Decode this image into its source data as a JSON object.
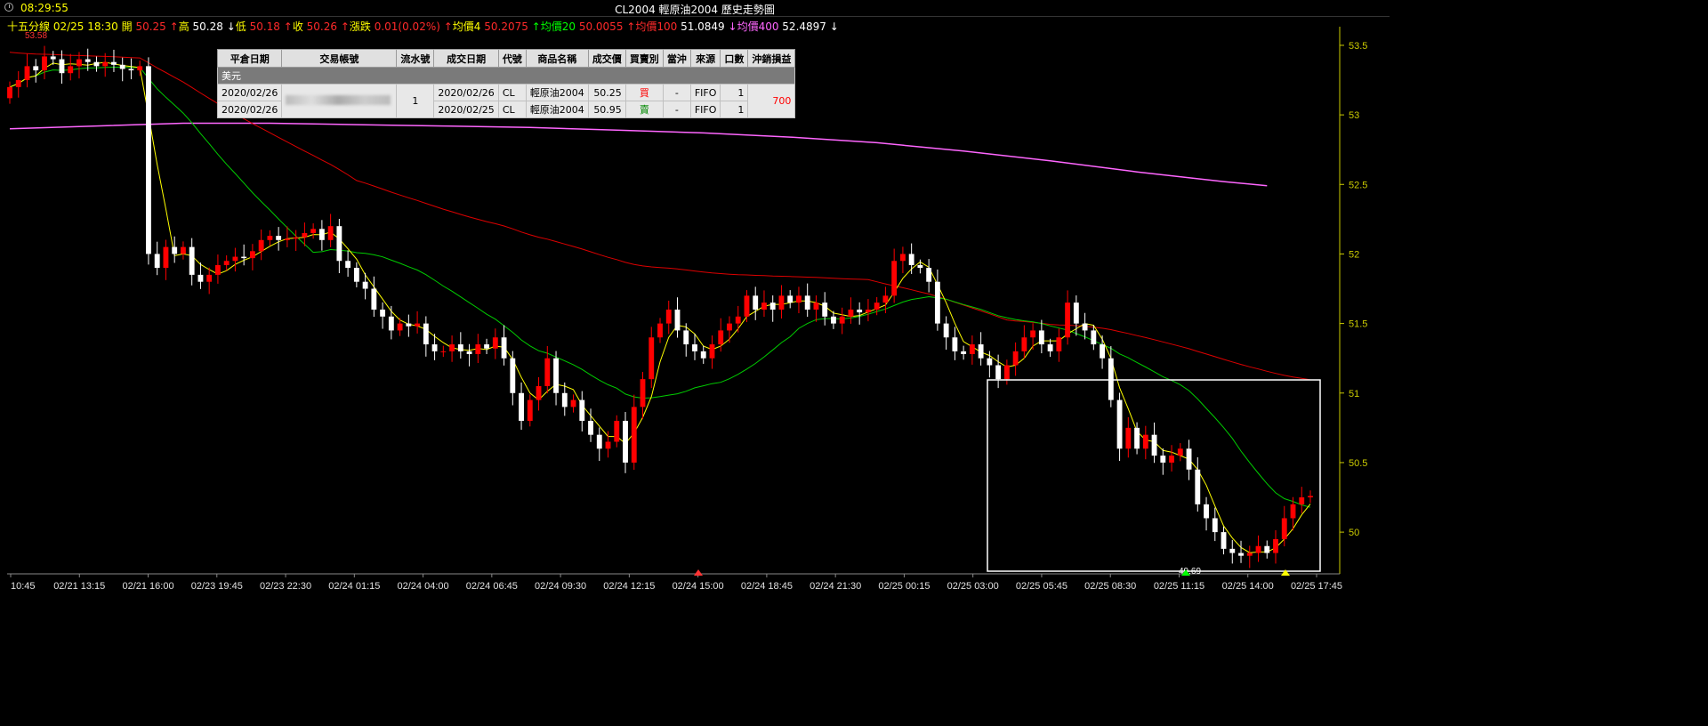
{
  "window": {
    "clock": "08:29:55",
    "title": "CL2004 輕原油2004  歷史走勢圖"
  },
  "info": [
    {
      "text": "十五分線",
      "color": "#ffff00"
    },
    {
      "text": " 02/25 18:30 ",
      "color": "#ffff00"
    },
    {
      "text": "開 ",
      "color": "#ffff00"
    },
    {
      "text": "50.25",
      "color": "#ff2a2a"
    },
    {
      "text": " ↑",
      "color": "#ff2a2a"
    },
    {
      "text": "高 ",
      "color": "#ffff00"
    },
    {
      "text": "50.28",
      "color": "#ffffff"
    },
    {
      "text": " ↓",
      "color": "#ffffff"
    },
    {
      "text": "低 ",
      "color": "#ffff00"
    },
    {
      "text": "50.18",
      "color": "#ff2a2a"
    },
    {
      "text": " ↑",
      "color": "#ff2a2a"
    },
    {
      "text": "收 ",
      "color": "#ffff00"
    },
    {
      "text": "50.26",
      "color": "#ff2a2a"
    },
    {
      "text": " ↑",
      "color": "#ff2a2a"
    },
    {
      "text": "漲跌 ",
      "color": "#ffff00"
    },
    {
      "text": "0.01(0.02%)",
      "color": "#ff2a2a"
    },
    {
      "text": " ↑",
      "color": "#ff2a2a"
    },
    {
      "text": "均價4 ",
      "color": "#ffff00"
    },
    {
      "text": "50.2075",
      "color": "#ff2a2a"
    },
    {
      "text": " ↑",
      "color": "#00ff00"
    },
    {
      "text": "均價20 ",
      "color": "#00ff00"
    },
    {
      "text": "50.0055",
      "color": "#ff2a2a"
    },
    {
      "text": " ↑",
      "color": "#ff2a2a"
    },
    {
      "text": "均價100 ",
      "color": "#ff2a2a"
    },
    {
      "text": "51.0849",
      "color": "#ffffff"
    },
    {
      "text": " ↓",
      "color": "#ff66ff"
    },
    {
      "text": "均價400 ",
      "color": "#ff66ff"
    },
    {
      "text": "52.4897",
      "color": "#ffffff"
    },
    {
      "text": " ↓",
      "color": "#ffffff"
    }
  ],
  "trades": {
    "headers": [
      "平倉日期",
      "交易帳號",
      "流水號",
      "成交日期",
      "代號",
      "商品名稱",
      "成交價",
      "買賣別",
      "當沖",
      "來源",
      "口數",
      "沖銷損益"
    ],
    "group": "美元",
    "serial": "1",
    "pnl": "700",
    "rows": [
      {
        "close_date": "2020/02/26",
        "trade_date": "2020/02/26",
        "symbol": "CL",
        "name": "輕原油2004",
        "price": "50.25",
        "side": "買",
        "side_color": "#ff0000",
        "daytrade": "-",
        "source": "FIFO",
        "qty": "1"
      },
      {
        "close_date": "2020/02/26",
        "trade_date": "2020/02/25",
        "symbol": "CL",
        "name": "輕原油2004",
        "price": "50.95",
        "side": "賣",
        "side_color": "#008800",
        "daytrade": "-",
        "source": "FIFO",
        "qty": "1"
      }
    ]
  },
  "chart_data": {
    "type": "candlestick",
    "interval": "十五分線",
    "ylim": [
      49.7,
      53.57
    ],
    "y_ticks": [
      "53.5",
      "53",
      "52.5",
      "52",
      "51.5",
      "51",
      "50.5",
      "50"
    ],
    "x_ticks": [
      "10:45",
      "02/21 13:15",
      "02/21 16:00",
      "02/23 19:45",
      "02/23 22:30",
      "02/24 01:15",
      "02/24 04:00",
      "02/24 06:45",
      "02/24 09:30",
      "02/24 12:15",
      "02/24 15:00",
      "02/24 18:45",
      "02/24 21:30",
      "02/25 00:15",
      "02/25 03:00",
      "02/25 05:45",
      "02/25 08:30",
      "02/25 11:15",
      "02/25 14:00",
      "02/25 17:45"
    ],
    "top_left_label": "53.58",
    "low_marker_label": "49.69",
    "colors": {
      "up": "#ff0000",
      "down": "#ffffff",
      "ma4": "#ffff00",
      "ma20": "#00cc00",
      "ma100": "#dd0000",
      "ma400": "#ff66ff",
      "axis": "#cccc00",
      "box": "#ffffff"
    },
    "ma400": [
      [
        0,
        52.9
      ],
      [
        10,
        52.92
      ],
      [
        20,
        52.94
      ],
      [
        30,
        52.94
      ],
      [
        40,
        52.93
      ],
      [
        50,
        52.92
      ],
      [
        60,
        52.91
      ],
      [
        70,
        52.89
      ],
      [
        80,
        52.87
      ],
      [
        90,
        52.84
      ],
      [
        100,
        52.8
      ],
      [
        110,
        52.74
      ],
      [
        120,
        52.67
      ],
      [
        130,
        52.59
      ],
      [
        140,
        52.52
      ],
      [
        145,
        52.49
      ]
    ],
    "closes": [
      53.2,
      53.25,
      53.35,
      53.32,
      53.42,
      53.4,
      53.3,
      53.35,
      53.4,
      53.38,
      53.35,
      53.38,
      53.36,
      53.33,
      53.32,
      53.35,
      52.0,
      51.9,
      52.05,
      52.0,
      52.05,
      51.85,
      51.8,
      51.85,
      51.92,
      51.95,
      51.98,
      51.97,
      52.02,
      52.1,
      52.13,
      52.1,
      52.11,
      52.12,
      52.15,
      52.18,
      52.1,
      52.2,
      51.95,
      51.9,
      51.8,
      51.75,
      51.6,
      51.55,
      51.45,
      51.5,
      51.48,
      51.5,
      51.35,
      51.3,
      51.3,
      51.35,
      51.3,
      51.28,
      51.35,
      51.32,
      51.4,
      51.25,
      51.0,
      50.8,
      50.95,
      51.05,
      51.25,
      51.0,
      50.9,
      50.95,
      50.8,
      50.7,
      50.6,
      50.65,
      50.8,
      50.5,
      50.9,
      51.1,
      51.4,
      51.5,
      51.6,
      51.45,
      51.35,
      51.3,
      51.25,
      51.35,
      51.45,
      51.5,
      51.55,
      51.7,
      51.6,
      51.65,
      51.6,
      51.7,
      51.65,
      51.7,
      51.6,
      51.65,
      51.55,
      51.5,
      51.55,
      51.6,
      51.58,
      51.6,
      51.65,
      51.7,
      51.95,
      52.0,
      51.92,
      51.9,
      51.8,
      51.5,
      51.4,
      51.3,
      51.28,
      51.35,
      51.25,
      51.2,
      51.1,
      51.2,
      51.3,
      51.4,
      51.45,
      51.35,
      51.3,
      51.4,
      51.65,
      51.5,
      51.45,
      51.35,
      51.25,
      50.95,
      50.6,
      50.75,
      50.6,
      50.7,
      50.55,
      50.5,
      50.55,
      50.6,
      50.45,
      50.2,
      50.1,
      50.0,
      49.88,
      49.85,
      49.83,
      49.85,
      49.9,
      49.85,
      49.95,
      50.1,
      50.2,
      50.25,
      50.26
    ]
  }
}
